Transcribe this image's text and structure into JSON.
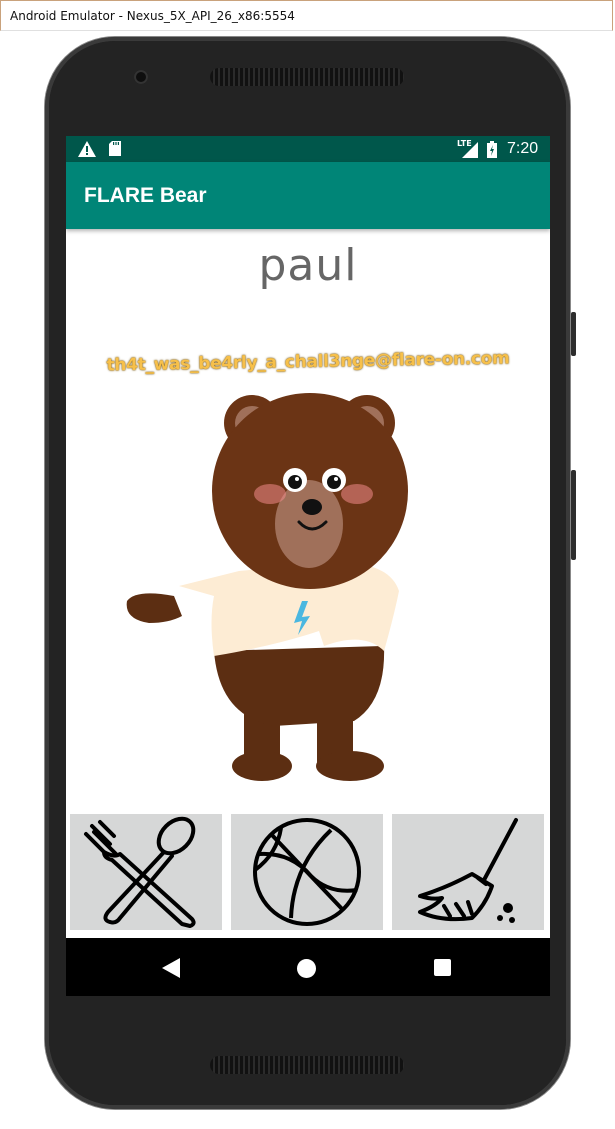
{
  "window": {
    "title": "Android Emulator - Nexus_5X_API_26_x86:5554"
  },
  "status_bar": {
    "time": "7:20",
    "network": "LTE",
    "icons": [
      "warning-icon",
      "sd-card-icon",
      "signal-icon",
      "battery-icon"
    ]
  },
  "app_bar": {
    "title": "FLARE Bear"
  },
  "content": {
    "bear_name": "paul",
    "flag_text": "th4t_was_be4rly_a_chall3nge@flare-on.com"
  },
  "actions": [
    {
      "name": "feed",
      "icon": "fork-spoon-icon"
    },
    {
      "name": "play",
      "icon": "ball-icon"
    },
    {
      "name": "clean",
      "icon": "broom-icon"
    }
  ],
  "nav_bar": {
    "icons": [
      "back-icon",
      "home-icon",
      "recents-icon"
    ]
  },
  "colors": {
    "status_bar": "#00574b",
    "app_bar": "#008577",
    "button_bg": "#d6d7d7",
    "flag": "#f7c04a"
  }
}
